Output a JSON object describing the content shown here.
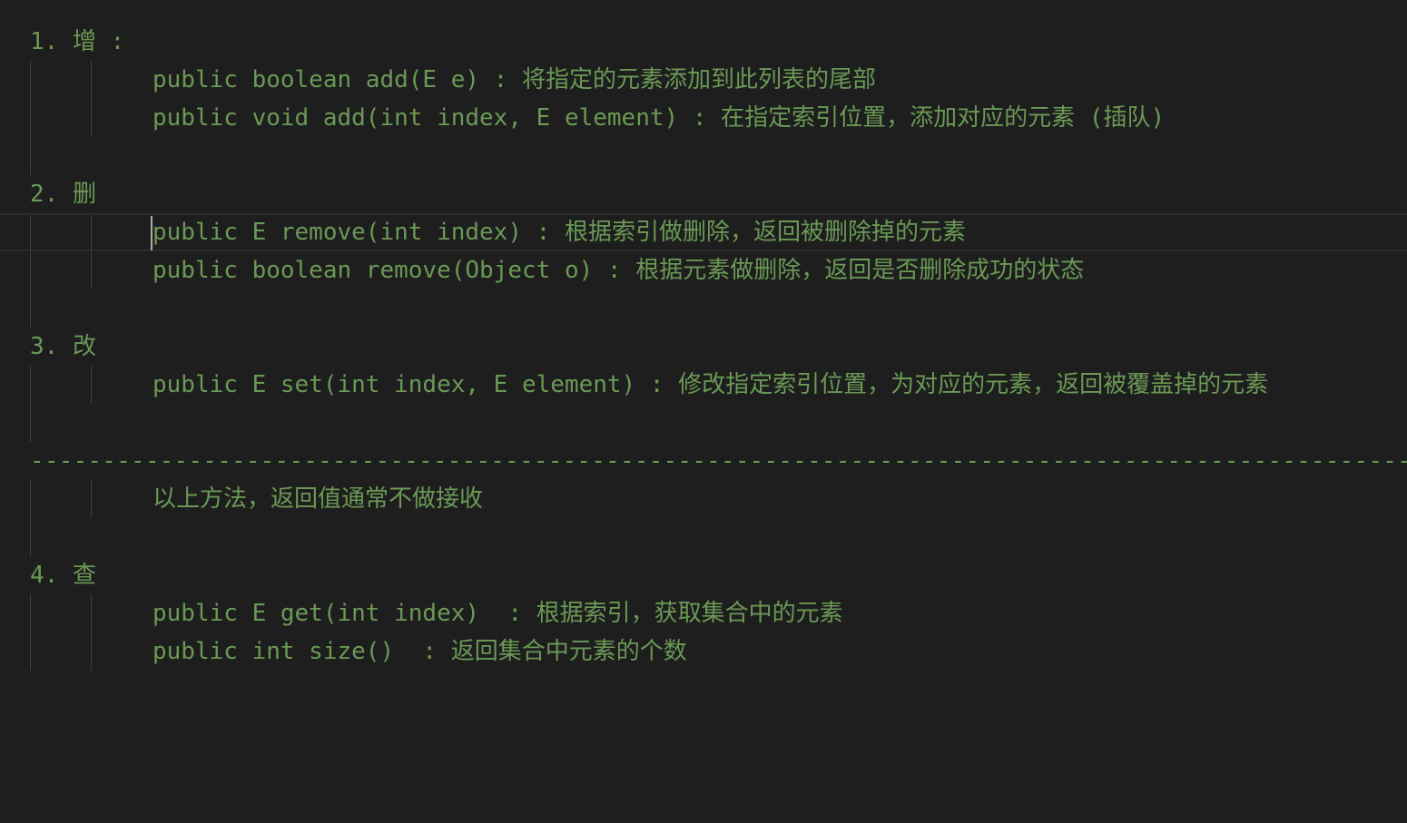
{
  "editor": {
    "lines": {
      "h1": "1. 增 :",
      "l1": "public boolean add(E e) : 将指定的元素添加到此列表的尾部",
      "l2": "public void add(int index, E element) : 在指定索引位置，添加对应的元素 (插队)",
      "h2": "2. 删",
      "l3": "public E remove(int index) : 根据索引做删除，返回被删除掉的元素",
      "l4": "public boolean remove(Object o) : 根据元素做删除，返回是否删除成功的状态",
      "h3": "3. 改",
      "l5": "public E set(int index, E element) : 修改指定索引位置，为对应的元素，返回被覆盖掉的元素",
      "separator": "----------------------------------------------------------------------------------------------------------------------------",
      "note": "以上方法，返回值通常不做接收",
      "h4": "4. 查",
      "l6": "public E get(int index)  : 根据索引，获取集合中的元素",
      "l7": "public int size()  : 返回集合中元素的个数"
    }
  },
  "theme": {
    "background": "#1e1e1e",
    "comment_text": "#6a9955",
    "indent_guide": "#404040",
    "cursor": "#aeafad"
  }
}
